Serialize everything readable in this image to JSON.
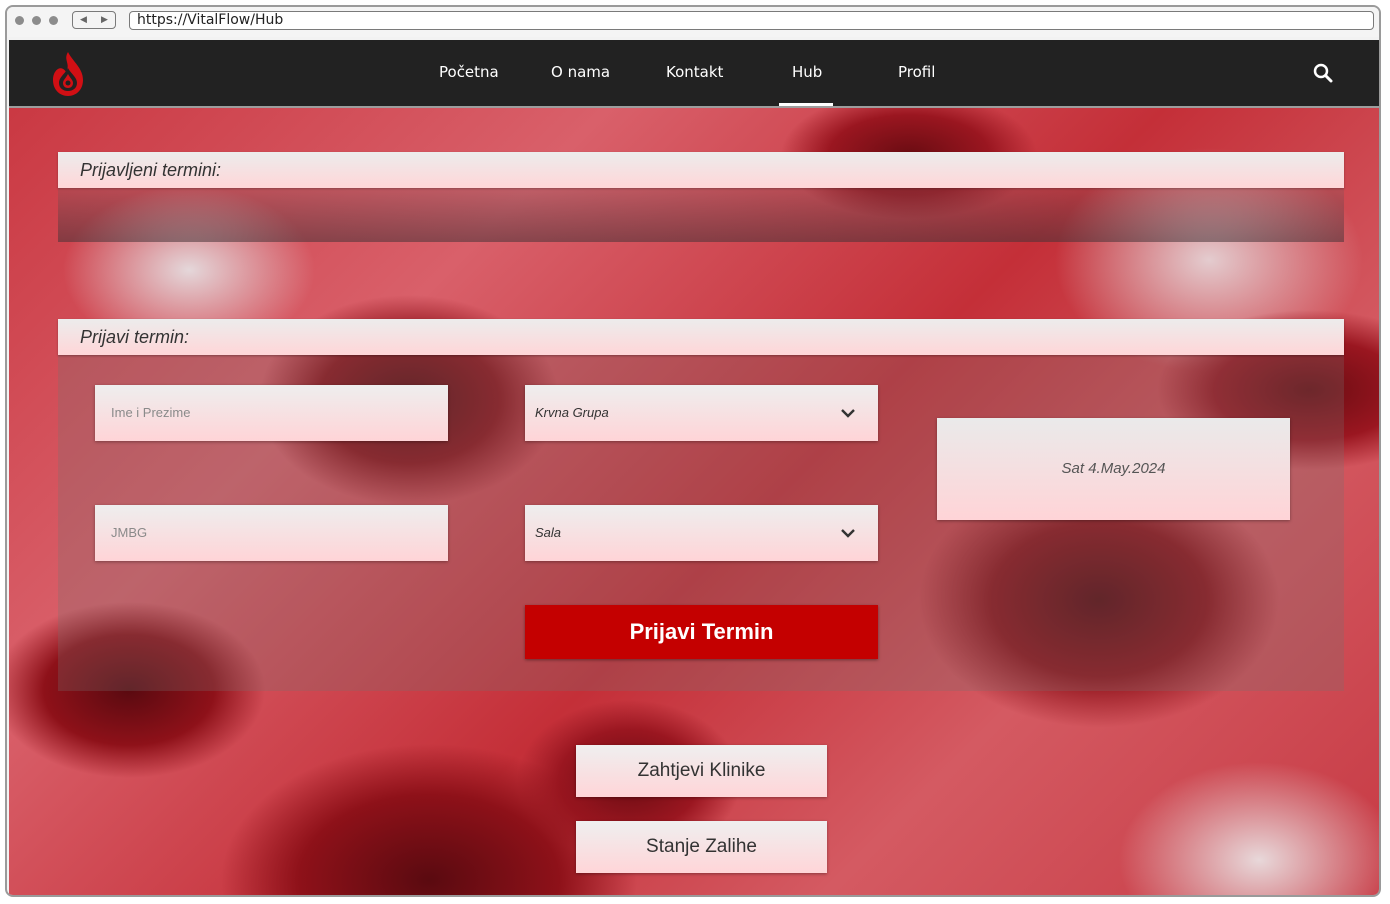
{
  "browser": {
    "url": "https://VitalFlow/Hub",
    "back_glyph": "◀",
    "forward_glyph": "▶"
  },
  "nav": {
    "items": [
      {
        "label": "Početna"
      },
      {
        "label": "O nama"
      },
      {
        "label": "Kontakt"
      },
      {
        "label": "Hub",
        "active": true
      },
      {
        "label": "Profil"
      }
    ],
    "logo_icon": "blood-drop-flame-icon",
    "search_icon": "search-icon"
  },
  "registered": {
    "title": "Prijavljeni termini:"
  },
  "form": {
    "title": "Prijavi termin:",
    "name_placeholder": "Ime i Prezime",
    "jmbg_placeholder": "JMBG",
    "blood_group_label": "Krvna Grupa",
    "room_label": "Sala",
    "date": "Sat 4.May.2024",
    "submit_label": "Prijavi Termin"
  },
  "actions": {
    "clinic_requests_label": "Zahtjevi Klinike",
    "stock_label": "Stanje Zalihe"
  },
  "colors": {
    "nav_bg": "#222222",
    "accent": "#c40000",
    "field_top": "#eeeeee",
    "field_bottom": "#ffd4d7"
  }
}
